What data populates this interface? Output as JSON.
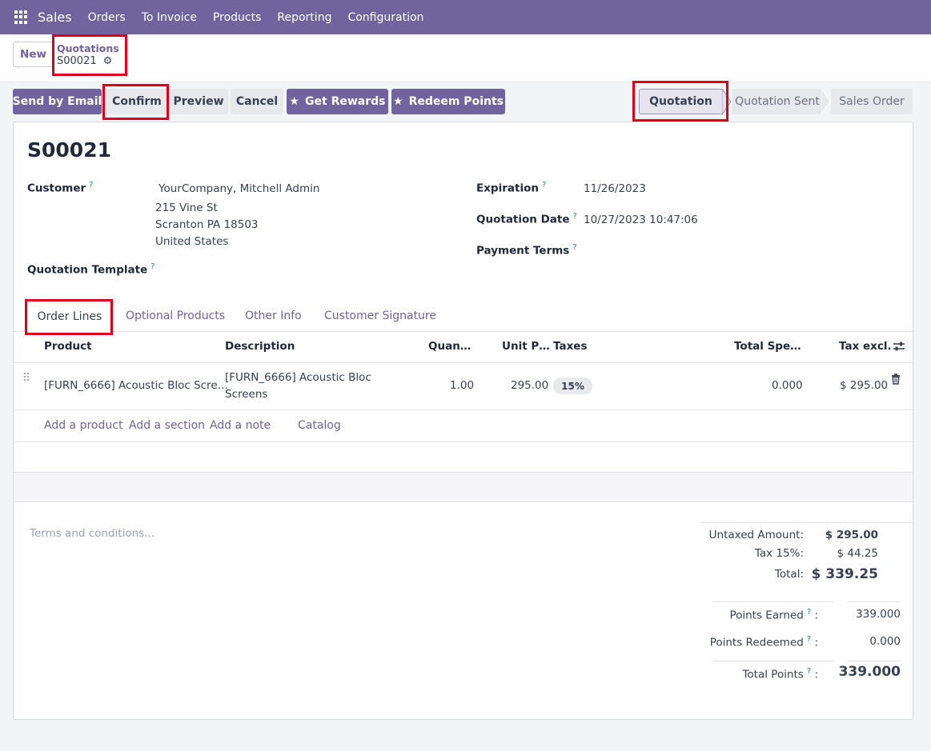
{
  "navbar": {
    "app_name": "Sales",
    "menu": [
      "Orders",
      "To Invoice",
      "Products",
      "Reporting",
      "Configuration"
    ]
  },
  "control": {
    "new_label": "New",
    "breadcrumb_parent": "Quotations",
    "breadcrumb_current": "S00021"
  },
  "actions": {
    "send_by_email": "Send by Email",
    "confirm": "Confirm",
    "preview": "Preview",
    "cancel": "Cancel",
    "get_rewards": "Get Rewards",
    "redeem_points": "Redeem Points"
  },
  "status": {
    "stages": [
      "Quotation",
      "Quotation Sent",
      "Sales Order"
    ],
    "active": "Quotation"
  },
  "form": {
    "title": "S00021",
    "customer_label": "Customer",
    "customer_name": "YourCompany, Mitchell Admin",
    "address_line1": "215 Vine St",
    "address_line2": "Scranton PA 18503",
    "address_line3": "United States",
    "quotation_template_label": "Quotation Template",
    "expiration_label": "Expiration",
    "expiration_value": "11/26/2023",
    "quotation_date_label": "Quotation Date",
    "quotation_date_value": "10/27/2023 10:47:06",
    "payment_terms_label": "Payment Terms"
  },
  "tabs": [
    "Order Lines",
    "Optional Products",
    "Other Info",
    "Customer Signature"
  ],
  "table": {
    "headers": {
      "product": "Product",
      "description": "Description",
      "quantity": "Quan…",
      "unit_price": "Unit P…",
      "taxes": "Taxes",
      "total_spent": "Total Spe…",
      "tax_excl": "Tax excl."
    },
    "rows": [
      {
        "product": "[FURN_6666] Acoustic Bloc Scre…",
        "description_line1": "[FURN_6666] Acoustic Bloc",
        "description_line2": "Screens",
        "quantity": "1.00",
        "unit_price": "295.00",
        "tax": "15%",
        "total_spent": "0.000",
        "subtotal": "$ 295.00"
      }
    ],
    "add_links": [
      "Add a product",
      "Add a section",
      "Add a note",
      "Catalog"
    ]
  },
  "footer": {
    "terms_placeholder": "Terms and conditions...",
    "untaxed_label": "Untaxed Amount:",
    "untaxed_value": "$ 295.00",
    "tax_label": "Tax 15%:",
    "tax_value": "$ 44.25",
    "total_label": "Total:",
    "total_value": "$ 339.25",
    "points_earned_label": "Points Earned",
    "points_earned_value": "339.000",
    "points_redeemed_label": "Points Redeemed",
    "points_redeemed_value": "0.000",
    "total_points_label": "Total Points",
    "total_points_value": "339.000"
  },
  "colors": {
    "brand": "#71639e",
    "highlight": "#e0001a"
  }
}
